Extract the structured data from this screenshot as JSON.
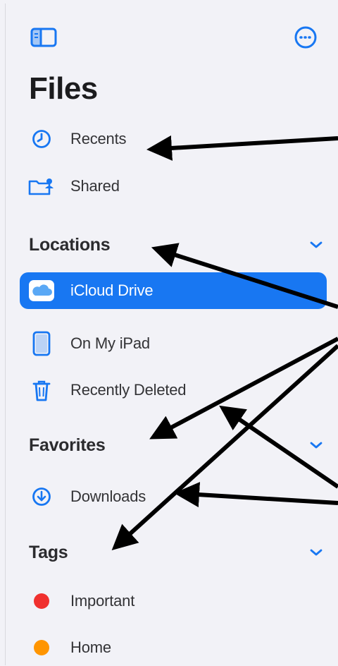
{
  "app": {
    "title": "Files"
  },
  "colors": {
    "accent": "#1877f2",
    "tag_important": "#f0302e",
    "tag_home": "#ff9500"
  },
  "icons": {
    "sidebar_toggle": "sidebar-toggle-icon",
    "more": "ellipsis-circle-icon",
    "recents": "clock-icon",
    "shared": "shared-folder-icon",
    "icloud": "cloud-icon",
    "on_my_ipad": "ipad-icon",
    "recently_deleted": "trash-icon",
    "downloads": "download-circle-icon",
    "chevron": "chevron-down-icon"
  },
  "top_items": [
    {
      "label": "Recents"
    },
    {
      "label": "Shared"
    }
  ],
  "locations": {
    "title": "Locations",
    "items": [
      {
        "label": "iCloud Drive",
        "selected": true
      },
      {
        "label": "On My iPad"
      },
      {
        "label": "Recently Deleted"
      }
    ]
  },
  "favorites": {
    "title": "Favorites",
    "items": [
      {
        "label": "Downloads"
      }
    ]
  },
  "tags": {
    "title": "Tags",
    "items": [
      {
        "label": "Important"
      },
      {
        "label": "Home"
      }
    ]
  }
}
